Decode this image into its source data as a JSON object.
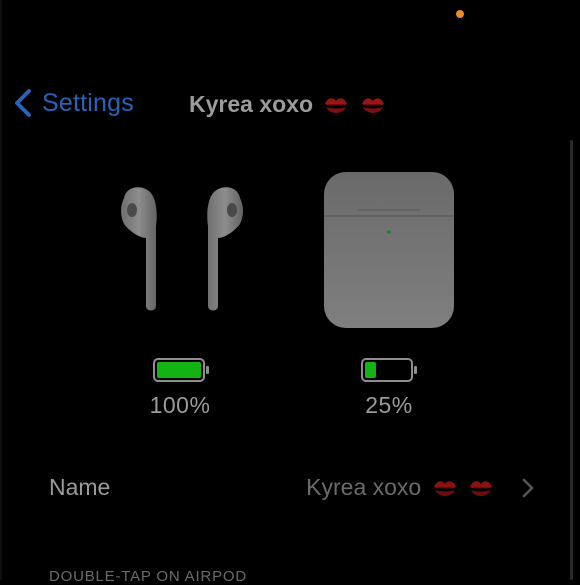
{
  "status_bar": {
    "indicator_color": "#f08a24"
  },
  "nav": {
    "back_label": "Settings",
    "title": "Kyrea xoxo",
    "title_emoji_count": 2,
    "accent_color": "#2a62b9"
  },
  "devices": {
    "airpods": {
      "battery_percent": 100,
      "battery_label": "100%",
      "battery_color": "#12b312",
      "icon": "airpods-icon"
    },
    "case": {
      "battery_percent": 25,
      "battery_label": "25%",
      "battery_color": "#12b312",
      "icon": "airpods-case-icon"
    }
  },
  "settings_rows": [
    {
      "label": "Name",
      "value": "Kyrea xoxo",
      "value_emoji_count": 2,
      "icon": "chevron-right-icon"
    }
  ],
  "section_header": "DOUBLE-TAP ON AIRPOD"
}
